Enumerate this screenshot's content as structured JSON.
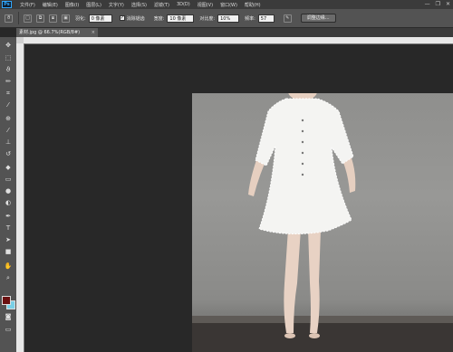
{
  "app": {
    "logo": "Ps"
  },
  "menu": [
    "文件(F)",
    "编辑(E)",
    "图像(I)",
    "图层(L)",
    "文字(Y)",
    "选择(S)",
    "滤镜(T)",
    "3D(D)",
    "视图(V)",
    "窗口(W)",
    "帮助(H)"
  ],
  "window_controls": {
    "minimize": "—",
    "restore": "❐",
    "close": "✕"
  },
  "options": {
    "feather_label": "羽化:",
    "feather_value": "0 像素",
    "antialias_label": "消除锯齿",
    "width_label": "宽度:",
    "width_value": "10 像素",
    "contrast_label": "对比度:",
    "contrast_value": "10%",
    "frequency_label": "频率:",
    "frequency_value": "57",
    "refine_edge_label": "调整边缘..."
  },
  "document_tab": {
    "title": "素材.jpg @ 66.7%(RGB/8#)",
    "close": "×"
  },
  "colors": {
    "foreground": "#6a1010",
    "background": "#7ad0e6"
  },
  "icons": {
    "tools": [
      "move-icon",
      "marquee-icon",
      "lasso-icon",
      "quick-select-icon",
      "crop-icon",
      "eyedropper-icon",
      "healing-brush-icon",
      "brush-icon",
      "clone-stamp-icon",
      "history-brush-icon",
      "eraser-icon",
      "gradient-icon",
      "blur-icon",
      "dodge-icon",
      "pen-icon",
      "type-icon",
      "path-select-icon",
      "shape-icon",
      "hand-icon",
      "zoom-icon"
    ]
  }
}
